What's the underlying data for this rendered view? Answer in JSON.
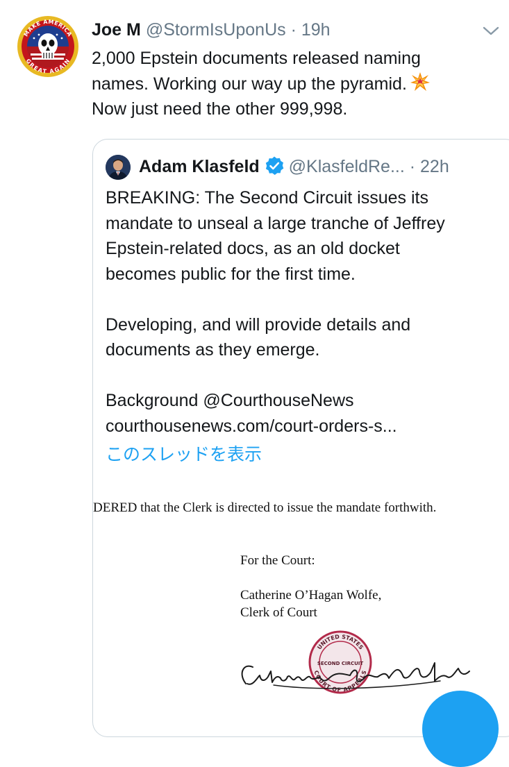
{
  "tweet": {
    "author_name": "Joe M",
    "author_handle": "@StormIsUponUs",
    "separator": "·",
    "time": "19h",
    "avatar_text_top": "MAKE AMERICA",
    "avatar_text_bottom": "GREAT AGAIN",
    "text_lines": [
      "2,000 Epstein documents released naming",
      "names. Working our way up the pyramid.",
      "Now just need the other 999,998."
    ],
    "emoji": "collision-emoji"
  },
  "quoted_tweet": {
    "author_name": "Adam Klasfeld",
    "author_handle": "@KlasfeldRe...",
    "separator": "·",
    "time": "22h",
    "verified": true,
    "paragraph1": [
      "BREAKING: The Second Circuit issues its",
      "mandate to unseal a large tranche of Jeffrey",
      "Epstein-related docs, as an old docket",
      "becomes public for the first time."
    ],
    "paragraph2": [
      "Developing, and will provide details and",
      "documents as they emerge."
    ],
    "paragraph3": [
      "Background @CourthouseNews",
      "courthousenews.com/court-orders-s..."
    ],
    "show_thread": "このスレッドを表示"
  },
  "document_image": {
    "line1": "DERED that the Clerk is directed to issue the mandate forthwith.",
    "for_court": "For the Court:",
    "signer_name": "Catherine O’Hagan Wolfe,",
    "signer_title": "Clerk of Court",
    "seal_top": "UNITED STATES",
    "seal_middle": "SECOND CIRCUIT",
    "seal_bottom": "COURT OF APPEALS",
    "signature_text": "Catherine O'Hagan Wolfe"
  },
  "colors": {
    "link_blue": "#1da1f2",
    "verified_blue": "#1da1f2",
    "muted_gray": "#657786",
    "border": "#ccd6dd"
  }
}
